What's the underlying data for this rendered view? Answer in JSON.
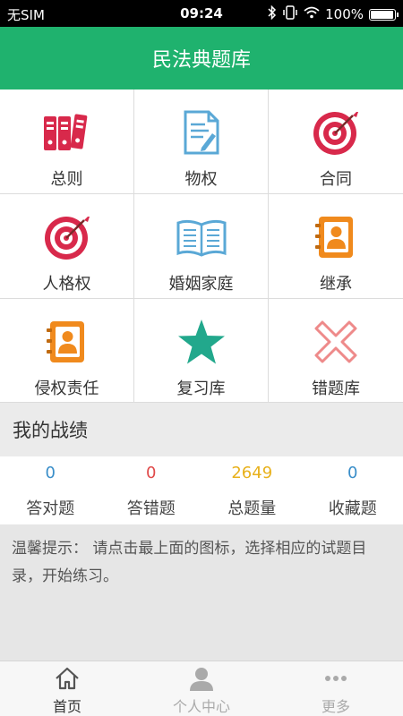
{
  "status_bar": {
    "carrier": "无SIM",
    "time": "09:24",
    "battery": "100%",
    "battery_level": 1.0
  },
  "header": {
    "title": "民法典题库"
  },
  "categories": [
    {
      "label": "总则",
      "icon": "binders-icon"
    },
    {
      "label": "物权",
      "icon": "document-edit-icon"
    },
    {
      "label": "合同",
      "icon": "target-icon"
    },
    {
      "label": "人格权",
      "icon": "target-icon"
    },
    {
      "label": "婚姻家庭",
      "icon": "open-book-icon"
    },
    {
      "label": "继承",
      "icon": "contact-book-icon"
    },
    {
      "label": "侵权责任",
      "icon": "contact-book-icon"
    },
    {
      "label": "复习库",
      "icon": "star-icon"
    },
    {
      "label": "错题库",
      "icon": "x-mark-icon"
    }
  ],
  "record": {
    "title": "我的战绩",
    "stats": [
      {
        "value": "0",
        "label": "答对题",
        "color": "#3a8ec9"
      },
      {
        "value": "0",
        "label": "答错题",
        "color": "#e04a4a"
      },
      {
        "value": "2649",
        "label": "总题量",
        "color": "#e8b11c"
      },
      {
        "value": "0",
        "label": "收藏题",
        "color": "#3a8ec9"
      }
    ]
  },
  "tip": {
    "text": "温馨提示： 请点击最上面的图标，选择相应的试题目录，开始练习。"
  },
  "bottom_nav": [
    {
      "label": "首页",
      "icon": "home-icon",
      "active": true
    },
    {
      "label": "个人中心",
      "icon": "user-icon",
      "active": false
    },
    {
      "label": "更多",
      "icon": "more-icon",
      "active": false
    }
  ],
  "colors": {
    "brand": "#1fb26e",
    "red": "#d8294b",
    "blue": "#5aa8d6",
    "orange": "#f08a1d",
    "teal": "#22a88c",
    "pink": "#ee8a8a",
    "nav_active": "#333333",
    "nav_inactive": "#aaaaaa"
  }
}
